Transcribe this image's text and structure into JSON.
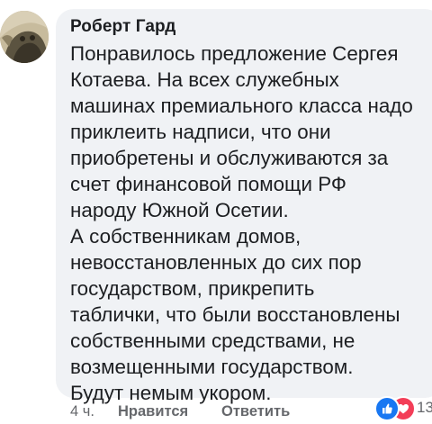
{
  "comment": {
    "author": "Роберт Гард",
    "text_lines": [
      "Понравилось предложение Сергея",
      "Котаева. На всех служебных",
      "машинах премиального класса надо",
      "приклеить надписи, что они",
      "приобретены и обслуживаются за",
      "счет финансовой помощи РФ",
      "народу Южной Осетии.",
      "А собственникам домов,",
      "невосстановленных до сих пор",
      "государством, прикрепить",
      "таблички, что были восстановлены",
      "собственными средствами, не",
      "возмещенными государством.",
      "Будут немым укором."
    ]
  },
  "actions": {
    "time": "4 ч.",
    "like_label": "Нравится",
    "reply_label": "Ответить"
  },
  "reactions": {
    "count": "13",
    "icons": [
      "like-icon",
      "love-icon"
    ]
  },
  "colors": {
    "bubble": "#f0f2f5",
    "text": "#1c1e21",
    "secondary_text": "#65676b",
    "like_blue": "#1877f2",
    "love_red": "#f33e58"
  }
}
